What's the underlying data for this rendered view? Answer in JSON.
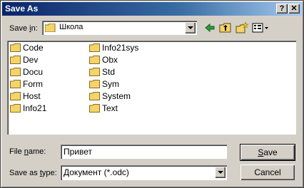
{
  "window": {
    "title": "Save As",
    "help_label": "?",
    "close_label": "✕"
  },
  "save_in": {
    "label_pre": "Save ",
    "label_key": "i",
    "label_post": "n:",
    "value": "Школа"
  },
  "toolbar": {
    "icons": [
      "back-icon",
      "up-folder-icon",
      "new-folder-icon",
      "view-menu-icon"
    ]
  },
  "files": {
    "col1": [
      "Code",
      "Dev",
      "Docu",
      "Form",
      "Host",
      "Info21"
    ],
    "col2": [
      "Info21sys",
      "Obx",
      "Std",
      "Sym",
      "System",
      "Text"
    ]
  },
  "filename": {
    "label_pre": "File ",
    "label_key": "n",
    "label_post": "ame:",
    "value": "Привет"
  },
  "filetype": {
    "label_pre": "Save as ",
    "label_key": "t",
    "label_post": "ype:",
    "value": "Документ (*.odc)"
  },
  "buttons": {
    "save_key": "S",
    "save_rest": "ave",
    "cancel": "Cancel"
  },
  "colors": {
    "titlebar": "#0a246a",
    "face": "#d4d0c8",
    "folder": "#f4d46a"
  }
}
